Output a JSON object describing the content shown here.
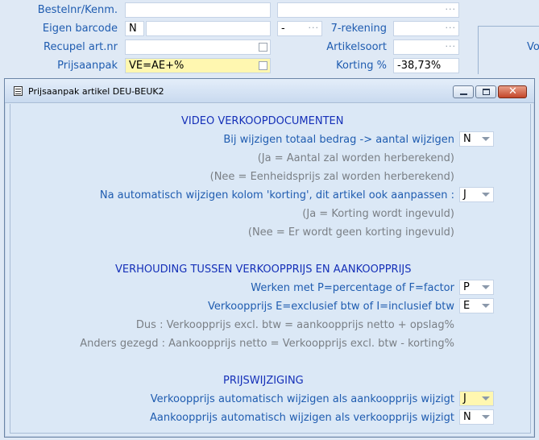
{
  "form": {
    "bestelnr_label": "Bestelnr/Kenm.",
    "eigen_barcode_label": "Eigen barcode",
    "eigen_barcode_value": "N",
    "recupel_label": "Recupel art.nr",
    "prijsaanpak_label": "Prijsaanpak",
    "prijsaanpak_value": "VE=AE+%",
    "dash_value": "-",
    "zeven_rekening_label": "7-rekening",
    "artikelsoort_label": "Artikelsoort",
    "korting_label": "Korting %",
    "korting_value": "-38,73%",
    "right_panel_text": "Vo",
    "dots": "···"
  },
  "dialog": {
    "title": "Prijsaanpak artikel DEU-BEUK2",
    "sections": [
      {
        "heading": "VIDEO VERKOOPDOCUMENTEN",
        "lines": [
          {
            "text": "Bij wijzigen totaal bedrag -> aantal wijzigen",
            "value": "N"
          },
          {
            "text": "(Ja  = Aantal zal worden herberekend)"
          },
          {
            "text": "(Nee = Eenheidsprijs zal worden herberekend)"
          },
          {
            "text": "Na automatisch wijzigen kolom 'korting', dit artikel ook aanpassen :",
            "value": "J"
          },
          {
            "text": "(Ja  = Korting wordt ingevuld)"
          },
          {
            "text": "(Nee = Er wordt geen korting ingevuld)"
          }
        ]
      },
      {
        "heading": "VERHOUDING TUSSEN VERKOOPPRIJS EN AANKOOPPRIJS",
        "lines": [
          {
            "text": "Werken met P=percentage of F=factor",
            "value": "P"
          },
          {
            "text": "Verkoopprijs E=exclusief btw of I=inclusief btw",
            "value": "E"
          },
          {
            "text": "Dus : Verkoopprijs excl. btw = aankoopprijs netto + opslag%"
          },
          {
            "text": "Anders gezegd : Aankoopprijs netto = Verkoopprijs excl. btw - korting%"
          }
        ]
      },
      {
        "heading": "PRIJSWIJZIGING",
        "lines": [
          {
            "text": "Verkoopprijs automatisch wijzigen als aankoopprijs wijzigt",
            "value": "J"
          },
          {
            "text": "Aankoopprijs automatisch wijzigen als verkoopprijs wijzigt",
            "value": "N"
          }
        ]
      }
    ]
  },
  "colors": {
    "highlight_yellow": "#fff7b0",
    "heading_blue": "#1530b8",
    "label_blue": "#1f5cb0",
    "hint_grey": "#7a7f85"
  },
  "icons": [
    "window-menu-icon",
    "minimize-icon",
    "maximize-icon",
    "close-icon",
    "chevron-down-icon",
    "ellipsis-icon"
  ]
}
